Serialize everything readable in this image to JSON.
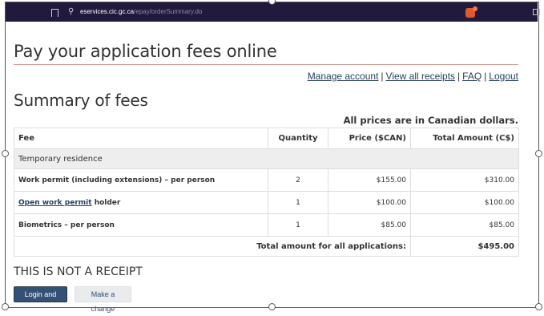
{
  "browser": {
    "url_domain": "eservices.cic.gc.ca",
    "url_path": "/epay/orderSummary.do"
  },
  "page": {
    "title": "Pay your application fees online",
    "nav": {
      "manage_account": "Manage account",
      "view_receipts": "View all receipts",
      "faq": "FAQ",
      "logout": "Logout",
      "separator": "|"
    },
    "summary_title": "Summary of fees",
    "currency_note": "All prices are in Canadian dollars."
  },
  "table": {
    "headers": {
      "fee": "Fee",
      "quantity": "Quantity",
      "price": "Price ($CAN)",
      "total": "Total Amount (C$)"
    },
    "group_label": "Temporary residence",
    "rows": [
      {
        "fee": "Work permit (including extensions) – per person",
        "quantity": "2",
        "price": "$155.00",
        "total": "$310.00"
      },
      {
        "fee_link": "Open work permit",
        "fee_suffix": "holder",
        "quantity": "1",
        "price": "$100.00",
        "total": "$100.00"
      },
      {
        "fee": "Biometrics – per person",
        "quantity": "1",
        "price": "$85.00",
        "total": "$85.00"
      }
    ],
    "total_label": "Total amount for all applications:",
    "total_value": "$495.00"
  },
  "not_receipt": "THIS IS NOT A RECEIPT",
  "buttons": {
    "login_pay": "Login and Pay",
    "make_change": "Make a change"
  },
  "colors": {
    "browser_bar": "#221a3d",
    "link": "#284162",
    "primary_button": "#335075",
    "title_rule": "#d59a93"
  },
  "icons": [
    "bookmark-icon",
    "site-settings-icon",
    "brave-shields-icon",
    "sidebar-toggle-icon"
  ]
}
